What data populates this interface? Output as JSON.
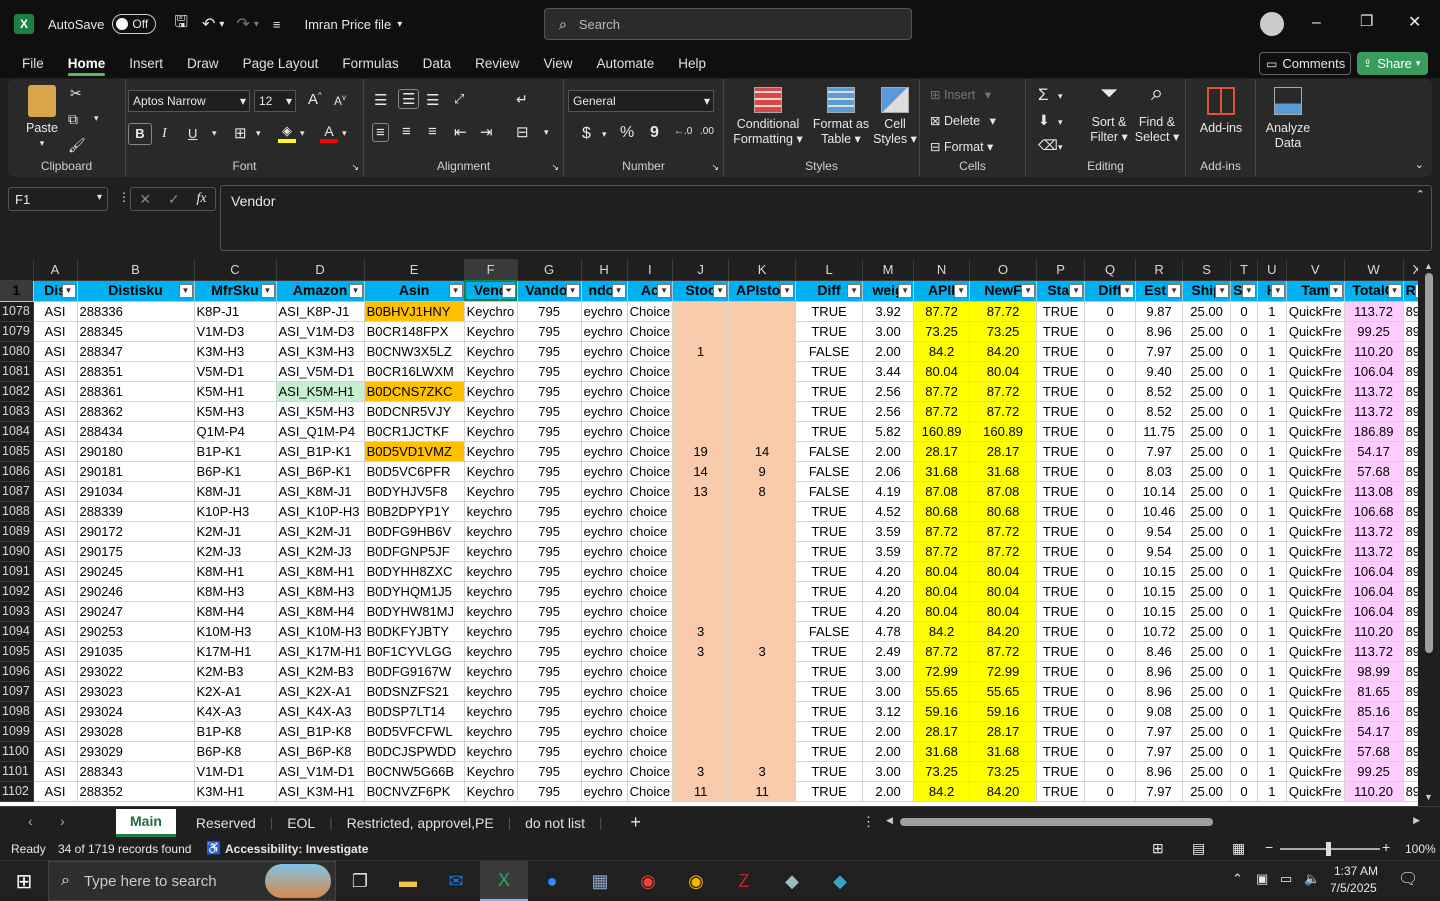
{
  "titlebar": {
    "autosave": "AutoSave",
    "toggle": "Off",
    "filename": "Imran Price file",
    "search_placeholder": "Search"
  },
  "tabs": [
    "File",
    "Home",
    "Insert",
    "Draw",
    "Page Layout",
    "Formulas",
    "Data",
    "Review",
    "View",
    "Automate",
    "Help"
  ],
  "tab_buttons": {
    "comments": "Comments",
    "share": "Share"
  },
  "ribbon": {
    "clipboard": {
      "paste": "Paste",
      "label": "Clipboard"
    },
    "font": {
      "name": "Aptos Narrow",
      "size": "12",
      "label": "Font",
      "bold": "B",
      "italic": "I",
      "underline": "U"
    },
    "alignment": {
      "label": "Alignment"
    },
    "number": {
      "format": "General",
      "label": "Number",
      "currency": "$",
      "percent": "%",
      "comma": "9"
    },
    "styles": {
      "cond1": "Conditional",
      "cond2": "Formatting",
      "fmt1": "Format as",
      "fmt2": "Table",
      "cell1": "Cell",
      "cell2": "Styles",
      "label": "Styles"
    },
    "cells": {
      "insert": "Insert",
      "delete": "Delete",
      "format": "Format",
      "label": "Cells"
    },
    "editing": {
      "sort1": "Sort &",
      "sort2": "Filter",
      "find1": "Find &",
      "find2": "Select",
      "label": "Editing"
    },
    "addins": {
      "addins": "Add-ins",
      "label": "Add-ins"
    },
    "analyze": {
      "l1": "Analyze",
      "l2": "Data"
    }
  },
  "formula": {
    "namebox": "F1",
    "fx": "fx",
    "content": "Vendor"
  },
  "columns": [
    "A",
    "B",
    "C",
    "D",
    "E",
    "F",
    "G",
    "H",
    "I",
    "J",
    "K",
    "L",
    "M",
    "N",
    "O",
    "P",
    "Q",
    "R",
    "S",
    "T",
    "U",
    "V",
    "W",
    "X"
  ],
  "header_row": {
    "num": "1",
    "cells": [
      "Dis",
      "Distisku",
      "MfrSku",
      "Amazon",
      "Asin",
      "Vend",
      "Vandor",
      "ndor",
      "Ac",
      "Stoc",
      "APIstoc",
      "Diff",
      "weig",
      "APII",
      "NewF",
      "Stat",
      "Diff",
      "Ests",
      "Ship",
      "Sul",
      "H",
      "Tam",
      "TotalC",
      "Ret"
    ]
  },
  "rows": [
    {
      "n": "1078",
      "b": "288336",
      "c": "K8P-J1",
      "d": "ASI_K8P-J1",
      "e": "B0BHVJ1HNY",
      "f": "Keychro",
      "i": "Choice",
      "j": "",
      "k": "",
      "l": "TRUE",
      "m": "3.92",
      "nn": "87.72",
      "o": "87.72",
      "r": "9.87",
      "w": "113.72"
    },
    {
      "n": "1079",
      "b": "288345",
      "c": "V1M-D3",
      "d": "ASI_V1M-D3",
      "e": "B0CR148FPX",
      "f": "Keychro",
      "i": "Choice",
      "j": "",
      "k": "",
      "l": "TRUE",
      "m": "3.00",
      "nn": "73.25",
      "o": "73.25",
      "r": "8.96",
      "w": "99.25"
    },
    {
      "n": "1080",
      "b": "288347",
      "c": "K3M-H3",
      "d": "ASI_K3M-H3",
      "e": "B0CNW3X5LZ",
      "f": "Keychro",
      "i": "Choice",
      "j": "1",
      "k": "",
      "l": "FALSE",
      "m": "2.00",
      "nn": "84.2",
      "o": "84.20",
      "r": "7.97",
      "w": "110.20"
    },
    {
      "n": "1081",
      "b": "288351",
      "c": "V5M-D1",
      "d": "ASI_V5M-D1",
      "e": "B0CR16LWXM",
      "f": "Keychro",
      "i": "Choice",
      "j": "",
      "k": "",
      "l": "TRUE",
      "m": "3.44",
      "nn": "80.04",
      "o": "80.04",
      "r": "9.40",
      "w": "106.04"
    },
    {
      "n": "1082",
      "b": "288361",
      "c": "K5M-H1",
      "d": "ASI_K5M-H1",
      "e": "B0DCNS7ZKC",
      "f": "Keychro",
      "i": "Choice",
      "j": "",
      "k": "",
      "l": "TRUE",
      "m": "2.56",
      "nn": "87.72",
      "o": "87.72",
      "r": "8.52",
      "w": "113.72"
    },
    {
      "n": "1083",
      "b": "288362",
      "c": "K5M-H3",
      "d": "ASI_K5M-H3",
      "e": "B0DCNR5VJY",
      "f": "Keychro",
      "i": "Choice",
      "j": "",
      "k": "",
      "l": "TRUE",
      "m": "2.56",
      "nn": "87.72",
      "o": "87.72",
      "r": "8.52",
      "w": "113.72"
    },
    {
      "n": "1084",
      "b": "288434",
      "c": "Q1M-P4",
      "d": "ASI_Q1M-P4",
      "e": "B0CR1JCTKF",
      "f": "Keychro",
      "i": "Choice",
      "j": "",
      "k": "",
      "l": "TRUE",
      "m": "5.82",
      "nn": "160.89",
      "o": "160.89",
      "r": "11.75",
      "w": "186.89"
    },
    {
      "n": "1085",
      "b": "290180",
      "c": "B1P-K1",
      "d": "ASI_B1P-K1",
      "e": "B0D5VD1VMZ",
      "f": "Keychro",
      "i": "Choice",
      "j": "19",
      "k": "14",
      "l": "FALSE",
      "m": "2.00",
      "nn": "28.17",
      "o": "28.17",
      "r": "7.97",
      "w": "54.17"
    },
    {
      "n": "1086",
      "b": "290181",
      "c": "B6P-K1",
      "d": "ASI_B6P-K1",
      "e": "B0D5VC6PFR",
      "f": "Keychro",
      "i": "Choice",
      "j": "14",
      "k": "9",
      "l": "FALSE",
      "m": "2.06",
      "nn": "31.68",
      "o": "31.68",
      "r": "8.03",
      "w": "57.68"
    },
    {
      "n": "1087",
      "b": "291034",
      "c": "K8M-J1",
      "d": "ASI_K8M-J1",
      "e": "B0DYHJV5F8",
      "f": "Keychro",
      "i": "Choice",
      "j": "13",
      "k": "8",
      "l": "FALSE",
      "m": "4.19",
      "nn": "87.08",
      "o": "87.08",
      "r": "10.14",
      "w": "113.08"
    },
    {
      "n": "1088",
      "b": "288339",
      "c": "K10P-H3",
      "d": "ASI_K10P-H3",
      "e": "B0B2DPYP1Y",
      "f": "keychro",
      "i": "choice",
      "j": "",
      "k": "",
      "l": "TRUE",
      "m": "4.52",
      "nn": "80.68",
      "o": "80.68",
      "r": "10.46",
      "w": "106.68"
    },
    {
      "n": "1089",
      "b": "290172",
      "c": "K2M-J1",
      "d": "ASI_K2M-J1",
      "e": "B0DFG9HB6V",
      "f": "keychro",
      "i": "choice",
      "j": "",
      "k": "",
      "l": "TRUE",
      "m": "3.59",
      "nn": "87.72",
      "o": "87.72",
      "r": "9.54",
      "w": "113.72"
    },
    {
      "n": "1090",
      "b": "290175",
      "c": "K2M-J3",
      "d": "ASI_K2M-J3",
      "e": "B0DFGNP5JF",
      "f": "keychro",
      "i": "choice",
      "j": "",
      "k": "",
      "l": "TRUE",
      "m": "3.59",
      "nn": "87.72",
      "o": "87.72",
      "r": "9.54",
      "w": "113.72"
    },
    {
      "n": "1091",
      "b": "290245",
      "c": "K8M-H1",
      "d": "ASI_K8M-H1",
      "e": "B0DYHH8ZXC",
      "f": "keychro",
      "i": "choice",
      "j": "",
      "k": "",
      "l": "TRUE",
      "m": "4.20",
      "nn": "80.04",
      "o": "80.04",
      "r": "10.15",
      "w": "106.04"
    },
    {
      "n": "1092",
      "b": "290246",
      "c": "K8M-H3",
      "d": "ASI_K8M-H3",
      "e": "B0DYHQM1J5",
      "f": "keychro",
      "i": "choice",
      "j": "",
      "k": "",
      "l": "TRUE",
      "m": "4.20",
      "nn": "80.04",
      "o": "80.04",
      "r": "10.15",
      "w": "106.04"
    },
    {
      "n": "1093",
      "b": "290247",
      "c": "K8M-H4",
      "d": "ASI_K8M-H4",
      "e": "B0DYHW81MJ",
      "f": "keychro",
      "i": "choice",
      "j": "",
      "k": "",
      "l": "TRUE",
      "m": "4.20",
      "nn": "80.04",
      "o": "80.04",
      "r": "10.15",
      "w": "106.04"
    },
    {
      "n": "1094",
      "b": "290253",
      "c": "K10M-H3",
      "d": "ASI_K10M-H3",
      "e": "B0DKFYJBTY",
      "f": "keychro",
      "i": "choice",
      "j": "3",
      "k": "",
      "l": "FALSE",
      "m": "4.78",
      "nn": "84.2",
      "o": "84.20",
      "r": "10.72",
      "w": "110.20"
    },
    {
      "n": "1095",
      "b": "291035",
      "c": "K17M-H1",
      "d": "ASI_K17M-H1",
      "e": "B0F1CYVLGG",
      "f": "keychro",
      "i": "choice",
      "j": "3",
      "k": "3",
      "l": "TRUE",
      "m": "2.49",
      "nn": "87.72",
      "o": "87.72",
      "r": "8.46",
      "w": "113.72"
    },
    {
      "n": "1096",
      "b": "293022",
      "c": "K2M-B3",
      "d": "ASI_K2M-B3",
      "e": "B0DFG9167W",
      "f": "keychro",
      "i": "choice",
      "j": "",
      "k": "",
      "l": "TRUE",
      "m": "3.00",
      "nn": "72.99",
      "o": "72.99",
      "r": "8.96",
      "w": "98.99"
    },
    {
      "n": "1097",
      "b": "293023",
      "c": "K2X-A1",
      "d": "ASI_K2X-A1",
      "e": "B0DSNZFS21",
      "f": "keychro",
      "i": "choice",
      "j": "",
      "k": "",
      "l": "TRUE",
      "m": "3.00",
      "nn": "55.65",
      "o": "55.65",
      "r": "8.96",
      "w": "81.65"
    },
    {
      "n": "1098",
      "b": "293024",
      "c": "K4X-A3",
      "d": "ASI_K4X-A3",
      "e": "B0DSP7LT14",
      "f": "keychro",
      "i": "choice",
      "j": "",
      "k": "",
      "l": "TRUE",
      "m": "3.12",
      "nn": "59.16",
      "o": "59.16",
      "r": "9.08",
      "w": "85.16"
    },
    {
      "n": "1099",
      "b": "293028",
      "c": "B1P-K8",
      "d": "ASI_B1P-K8",
      "e": "B0D5VFCFWL",
      "f": "keychro",
      "i": "choice",
      "j": "",
      "k": "",
      "l": "TRUE",
      "m": "2.00",
      "nn": "28.17",
      "o": "28.17",
      "r": "7.97",
      "w": "54.17"
    },
    {
      "n": "1100",
      "b": "293029",
      "c": "B6P-K8",
      "d": "ASI_B6P-K8",
      "e": "B0DCJSPWDD",
      "f": "keychro",
      "i": "choice",
      "j": "",
      "k": "",
      "l": "TRUE",
      "m": "2.00",
      "nn": "31.68",
      "o": "31.68",
      "r": "7.97",
      "w": "57.68"
    },
    {
      "n": "1101",
      "b": "288343",
      "c": "V1M-D1",
      "d": "ASI_V1M-D1",
      "e": "B0CNW5G66B",
      "f": "Keychro",
      "i": "Choice",
      "j": "3",
      "k": "3",
      "l": "TRUE",
      "m": "3.00",
      "nn": "73.25",
      "o": "73.25",
      "r": "8.96",
      "w": "99.25"
    },
    {
      "n": "1102",
      "b": "288352",
      "c": "K3M-H1",
      "d": "ASI_K3M-H1",
      "e": "B0CNVZF6PK",
      "f": "Keychro",
      "i": "Choice",
      "j": "11",
      "k": "11",
      "l": "TRUE",
      "m": "2.00",
      "nn": "84.2",
      "o": "84.20",
      "r": "7.97",
      "w": "110.20"
    }
  ],
  "fixed_cells": {
    "a": "ASI",
    "g": "795",
    "h": "eychro",
    "p": "TRUE",
    "q": "0",
    "s": "25.00",
    "t": "0",
    "u": "1",
    "v": "QuickFre",
    "x": "89"
  },
  "sheets": [
    "Main",
    "Reserved",
    "EOL",
    "Restricted, approvel,PE",
    "do not list"
  ],
  "status": {
    "ready": "Ready",
    "records": "34 of 1719 records found",
    "accessibility": "Accessibility: Investigate",
    "zoom": "100%"
  },
  "taskbar": {
    "search": "Type here to search",
    "time": "1:37 AM",
    "date": "7/5/2025"
  }
}
